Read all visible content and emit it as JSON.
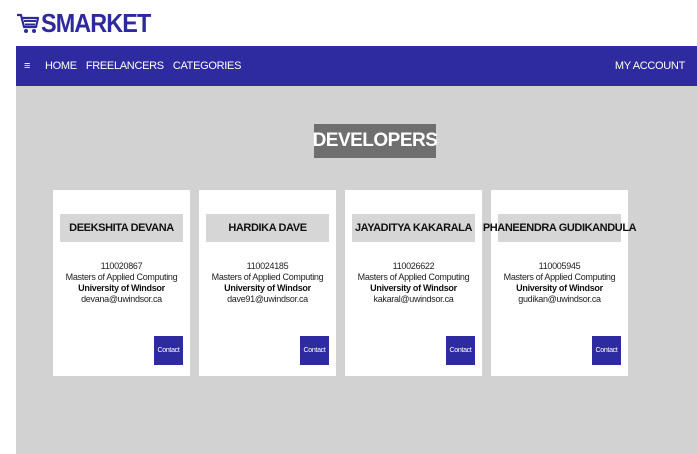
{
  "logo": {
    "brand_text": "SMARKET",
    "icon": "shopping-cart-icon"
  },
  "nav": {
    "menu_icon": "≡",
    "items": [
      {
        "label": "HOME"
      },
      {
        "label": "FREELANCERS"
      },
      {
        "label": "CATEGORIES"
      }
    ],
    "account_label": "MY ACCOUNT"
  },
  "page": {
    "title": "DEVELOPERS"
  },
  "developers": [
    {
      "name": "DEEKSHITA DEVANA",
      "id": "110020867",
      "program": "Masters of Applied Computing",
      "university": "University of Windsor",
      "email": "devana@uwindsor.ca",
      "contact_label": "Contact"
    },
    {
      "name": "HARDIKA DAVE",
      "id": "110024185",
      "program": "Masters of Applied Computing",
      "university": "University of Windsor",
      "email": "dave91@uwindsor.ca",
      "contact_label": "Contact"
    },
    {
      "name": "JAYADITYA KAKARALA",
      "id": "110026622",
      "program": "Masters of Applied Computing",
      "university": "University of Windsor",
      "email": "kakaral@uwindsor.ca",
      "contact_label": "Contact"
    },
    {
      "name": "PHANEENDRA GUDIKANDULA",
      "id": "110005945",
      "program": "Masters of Applied Computing",
      "university": "University of Windsor",
      "email": "gudikan@uwindsor.ca",
      "contact_label": "Contact"
    }
  ],
  "colors": {
    "brand": "#2e2aa0",
    "background": "#d2d2d2",
    "title_bg": "#6f6f6f",
    "name_bg": "#d6d6d6"
  }
}
